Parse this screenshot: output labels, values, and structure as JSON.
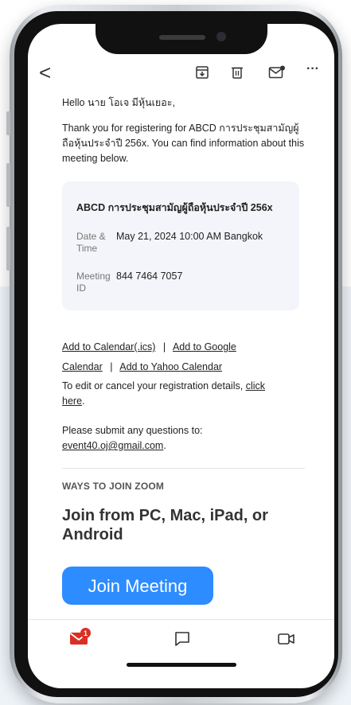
{
  "toolbar": {
    "back": "<",
    "icons": [
      "archive-icon",
      "trash-icon",
      "mark-unread-icon",
      "more-icon"
    ],
    "more": "···"
  },
  "email": {
    "greeting": "Hello นาย โอเจ มีหุ้นเยอะ,",
    "thanks": "Thank you for registering for ABCD การประชุมสามัญผู้ถือหุ้นประจำปี 256x. You can find information about this meeting below.",
    "card": {
      "title": "ABCD การประชุมสามัญผู้ถือหุ้นประจำปี 256x",
      "date_label_line1": "Date &",
      "date_label_line2": "Time",
      "date_value": "May 21, 2024 10:00 AM Bangkok",
      "meeting_label_line1": "Meeting",
      "meeting_label_line2": "ID",
      "meeting_value": "844 7464 7057"
    },
    "calendar": {
      "ics": "Add to Calendar(.ics)",
      "sep1": "|",
      "google_part1": "Add to Google",
      "google_part2": "Calendar",
      "sep2": "|",
      "yahoo": "Add to Yahoo Calendar"
    },
    "edit_text": "To edit or cancel your registration details,",
    "click_here_1": "click",
    "click_here_2": "here",
    "period": ".",
    "submit_text": "Please submit any questions to:",
    "submit_email": "event40.oj@gmail.com",
    "ways_heading": "WAYS TO JOIN ZOOM",
    "join_heading": "Join from PC, Mac, iPad, or Android",
    "join_button": "Join Meeting"
  },
  "bottombar": {
    "mail_badge": "1"
  },
  "colors": {
    "zoom_blue": "#2d8cff",
    "badge_red": "#d93025",
    "mail_red": "#d93025"
  }
}
